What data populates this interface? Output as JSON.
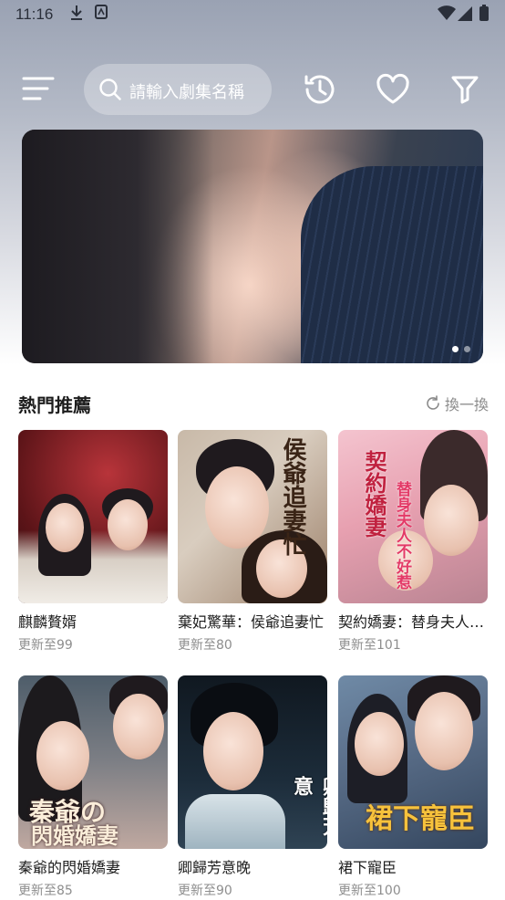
{
  "status": {
    "time": "11:16"
  },
  "header": {
    "search_placeholder": "請輸入劇集名稱"
  },
  "banner": {
    "slide_count": 2,
    "active_slide": 1
  },
  "section": {
    "title": "熱門推薦",
    "refresh_label": "換一換"
  },
  "dramas": [
    {
      "title": "麒麟贅婿",
      "update": "更新至99"
    },
    {
      "title": "棄妃驚華：侯爺追妻忙",
      "update": "更新至80"
    },
    {
      "title": "契約嬌妻：替身夫人不…",
      "update": "更新至101"
    },
    {
      "title": "秦爺的閃婚嬌妻",
      "update": "更新至85"
    },
    {
      "title": "卿歸芳意晚",
      "update": "更新至90"
    },
    {
      "title": "裙下寵臣",
      "update": "更新至100"
    }
  ],
  "colors": {
    "accent_text": "#1d1d1d",
    "muted_text": "#8e8e8e"
  }
}
